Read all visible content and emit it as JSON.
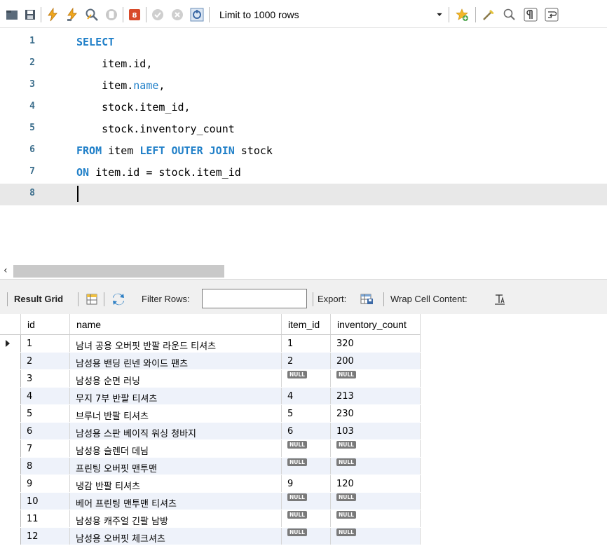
{
  "toolbar": {
    "limit_label": "Limit to 1000 rows",
    "buttons": [
      {
        "name": "open-file-icon"
      },
      {
        "name": "save-icon"
      },
      {
        "name": "execute-all-icon"
      },
      {
        "name": "execute-current-icon"
      },
      {
        "name": "explain-icon"
      },
      {
        "name": "stop-icon"
      },
      {
        "name": "toggle-continue-on-error-icon"
      },
      {
        "name": "commit-icon"
      },
      {
        "name": "rollback-icon"
      },
      {
        "name": "autocommit-icon"
      },
      {
        "name": "add-snippet-icon"
      },
      {
        "name": "beautify-icon"
      },
      {
        "name": "find-icon"
      },
      {
        "name": "invisible-characters-icon"
      },
      {
        "name": "wrap-lines-icon"
      }
    ]
  },
  "editor": {
    "line_numbers": [
      "1",
      "2",
      "3",
      "4",
      "5",
      "6",
      "7",
      "8"
    ],
    "lines": [
      [
        {
          "t": "SELECT",
          "k": "kw"
        }
      ],
      [
        {
          "t": "    item.id,",
          "k": ""
        }
      ],
      [
        {
          "t": "    item.",
          "k": ""
        },
        {
          "t": "name",
          "k": "id"
        },
        {
          "t": ",",
          "k": ""
        }
      ],
      [
        {
          "t": "    stock.item_id,",
          "k": ""
        }
      ],
      [
        {
          "t": "    stock.inventory_count",
          "k": ""
        }
      ],
      [
        {
          "t": "FROM",
          "k": "kw"
        },
        {
          "t": " item ",
          "k": ""
        },
        {
          "t": "LEFT OUTER JOIN",
          "k": "kw"
        },
        {
          "t": " stock",
          "k": ""
        }
      ],
      [
        {
          "t": "ON",
          "k": "kw"
        },
        {
          "t": " item.id = stock.item_id",
          "k": ""
        }
      ],
      []
    ],
    "current_line": 8
  },
  "result_toolbar": {
    "result_grid_label": "Result Grid",
    "filter_label": "Filter Rows:",
    "filter_value": "",
    "export_label": "Export:",
    "wrap_label": "Wrap Cell Content:"
  },
  "grid": {
    "columns": [
      "id",
      "name",
      "item_id",
      "inventory_count"
    ],
    "null_label": "NULL",
    "rows": [
      {
        "id": "1",
        "name": "남녀 공용 오버핏 반팔 라운드 티셔츠",
        "item_id": "1",
        "inventory_count": "320"
      },
      {
        "id": "2",
        "name": "남성용 밴딩 린넨 와이드 팬츠",
        "item_id": "2",
        "inventory_count": "200"
      },
      {
        "id": "3",
        "name": "남성용 순면 러닝",
        "item_id": null,
        "inventory_count": null
      },
      {
        "id": "4",
        "name": "무지 7부 반팔 티셔츠",
        "item_id": "4",
        "inventory_count": "213"
      },
      {
        "id": "5",
        "name": "브루너 반팔 티셔츠",
        "item_id": "5",
        "inventory_count": "230"
      },
      {
        "id": "6",
        "name": "남성용 스판 베이직 워싱 청바지",
        "item_id": "6",
        "inventory_count": "103"
      },
      {
        "id": "7",
        "name": "남성용 슬렌더 데님",
        "item_id": null,
        "inventory_count": null
      },
      {
        "id": "8",
        "name": "프린팅 오버핏 맨투맨",
        "item_id": null,
        "inventory_count": null
      },
      {
        "id": "9",
        "name": "냉감 반팔 티셔츠",
        "item_id": "9",
        "inventory_count": "120"
      },
      {
        "id": "10",
        "name": "베어 프린팅 맨투맨 티셔츠",
        "item_id": null,
        "inventory_count": null
      },
      {
        "id": "11",
        "name": "남성용 캐주얼 긴팔 남방",
        "item_id": null,
        "inventory_count": null
      },
      {
        "id": "12",
        "name": "남성용 오버핏 체크셔츠",
        "item_id": null,
        "inventory_count": null
      }
    ],
    "selected_row": 1
  },
  "colors": {
    "keyword": "#1f7fc8",
    "line_number": "#3c6e8c",
    "current_line": "#e8e8e8",
    "alt_row": "#eef2fa",
    "null_badge": "#7a7a7a"
  }
}
